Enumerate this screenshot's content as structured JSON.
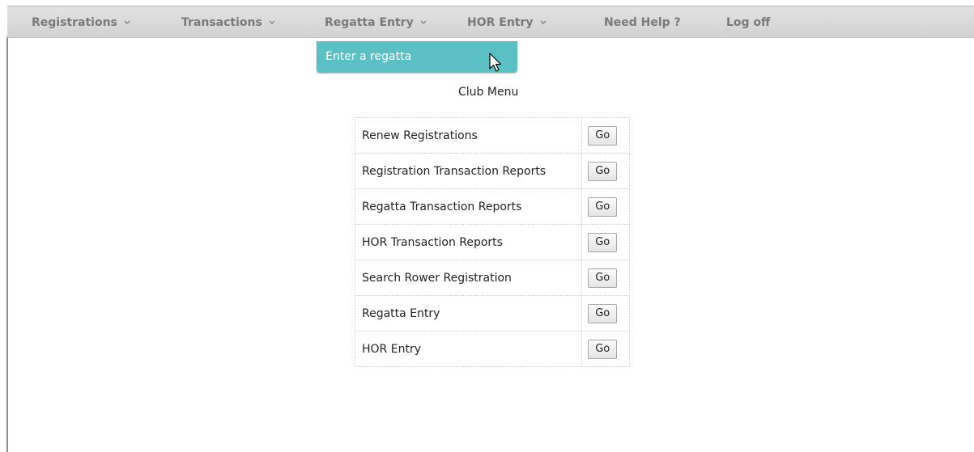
{
  "nav": {
    "items": [
      {
        "label": "Registrations",
        "dropdown": true
      },
      {
        "label": "Transactions",
        "dropdown": true
      },
      {
        "label": "Regatta Entry",
        "dropdown": true
      },
      {
        "label": "HOR Entry",
        "dropdown": true
      },
      {
        "label": "Need Help ?",
        "dropdown": false
      },
      {
        "label": "Log off",
        "dropdown": false
      }
    ],
    "open_dropdown": {
      "parent": "Regatta Entry",
      "items": [
        "Enter a regatta"
      ]
    }
  },
  "main": {
    "title": "Club Menu",
    "rows": [
      {
        "label": "Renew Registrations",
        "button": "Go"
      },
      {
        "label": "Registration Transaction Reports",
        "button": "Go"
      },
      {
        "label": "Regatta Transaction Reports",
        "button": "Go"
      },
      {
        "label": "HOR Transaction Reports",
        "button": "Go"
      },
      {
        "label": "Search Rower Registration",
        "button": "Go"
      },
      {
        "label": "Regatta Entry",
        "button": "Go"
      },
      {
        "label": "HOR Entry",
        "button": "Go"
      }
    ]
  },
  "icons": {
    "nav_dropdown": "chevron-down-icon",
    "cursor": "mouse-pointer-icon"
  },
  "colors": {
    "navbar_bg": "#d8d8d8",
    "nav_text": "#7a7a7a",
    "dropdown_bg": "#5bc0c4",
    "dropdown_text": "#ffffff"
  }
}
